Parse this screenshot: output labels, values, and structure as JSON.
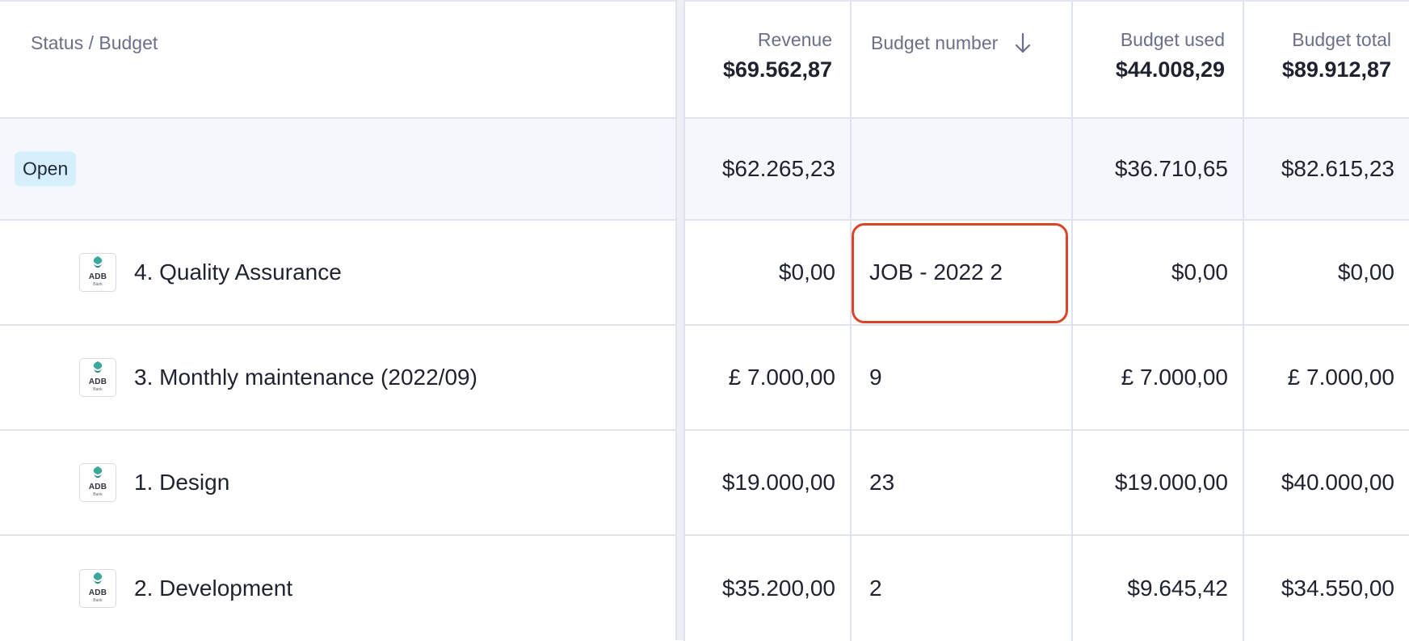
{
  "header": {
    "status_label": "Status / Budget",
    "revenue_label": "Revenue",
    "revenue_total": "$69.562,87",
    "budget_number_label": "Budget number",
    "budget_used_label": "Budget used",
    "budget_used_total": "$44.008,29",
    "budget_total_label": "Budget total",
    "budget_total_total": "$89.912,87"
  },
  "group": {
    "status": "Open",
    "revenue": "$62.265,23",
    "budget_number": "",
    "budget_used": "$36.710,65",
    "budget_total": "$82.615,23"
  },
  "rows": [
    {
      "logo_text": "ADB",
      "logo_sub": "Bank",
      "name": "4. Quality Assurance",
      "revenue": "$0,00",
      "budget_number": "JOB - 2022 2",
      "budget_used": "$0,00",
      "budget_total": "$0,00"
    },
    {
      "logo_text": "ADB",
      "logo_sub": "Bank",
      "name": "3. Monthly maintenance (2022/09)",
      "revenue": "£ 7.000,00",
      "budget_number": "9",
      "budget_used": "£ 7.000,00",
      "budget_total": "£ 7.000,00"
    },
    {
      "logo_text": "ADB",
      "logo_sub": "Bank",
      "name": "1. Design",
      "revenue": "$19.000,00",
      "budget_number": "23",
      "budget_used": "$19.000,00",
      "budget_total": "$40.000,00"
    },
    {
      "logo_text": "ADB",
      "logo_sub": "Bank",
      "name": "2. Development",
      "revenue": "$35.200,00",
      "budget_number": "2",
      "budget_used": "$9.645,42",
      "budget_total": "$34.550,00"
    }
  ],
  "icons": {
    "sort": "arrow-down-icon",
    "logo": "adb-bank-logo"
  },
  "colors": {
    "highlight": "#d9442b",
    "badge_bg": "#d6f0fb",
    "group_bg": "#f5f7fc"
  }
}
